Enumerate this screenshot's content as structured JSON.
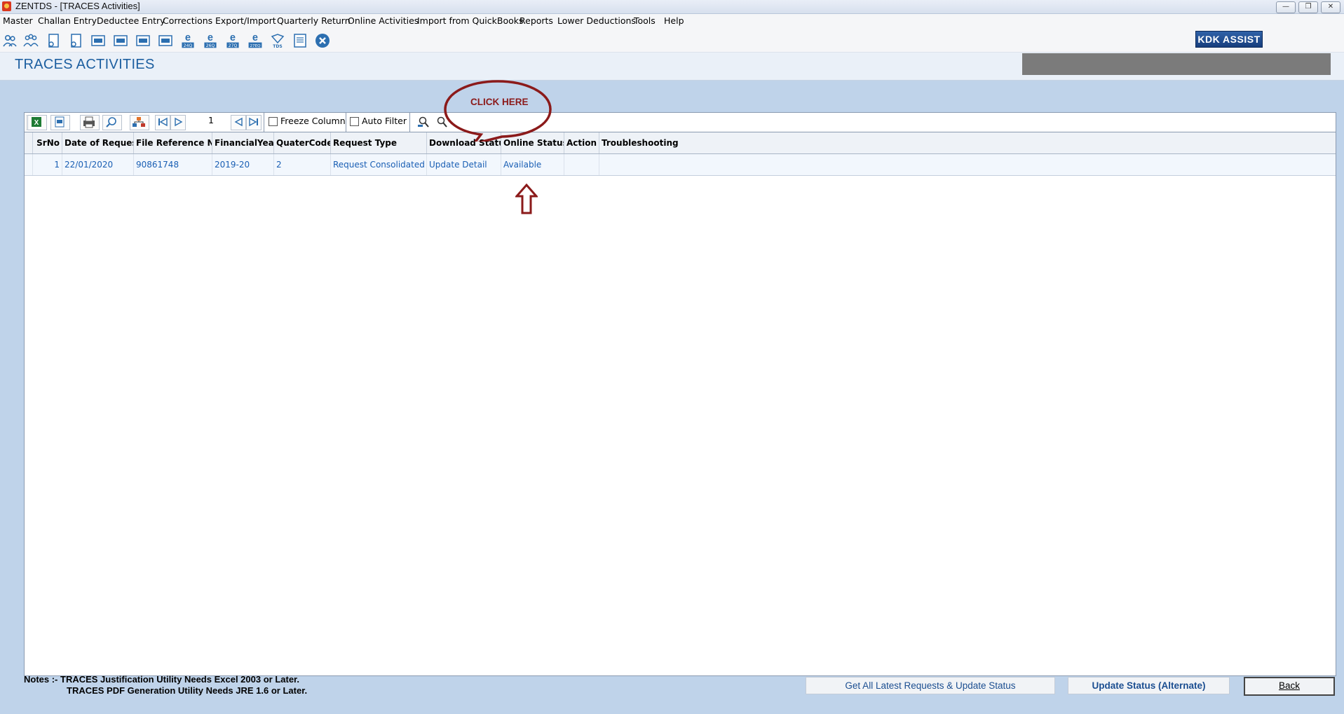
{
  "window": {
    "title": "ZENTDS - [TRACES Activities]",
    "buttons": [
      "minimize",
      "restore",
      "close"
    ]
  },
  "menu": [
    "Master",
    "Challan Entry",
    "Deductee Entry",
    "Corrections",
    "Export/Import",
    "Quarterly Return",
    "Online Activities",
    "Import from QuickBooks",
    "Reports",
    "Lower Deductions",
    "Tools",
    "Help"
  ],
  "toolbar": {
    "icons": [
      "deductor-icon",
      "deductees-icon",
      "form-icon",
      "form-icon-2",
      "form-24q-icon",
      "form-26q-icon",
      "form-27q-icon",
      "form-27eq-icon",
      "etds-24q-icon",
      "etds-26q-icon",
      "etds-27q-icon",
      "etds-27eq-icon",
      "tds-icon",
      "report-icon",
      "close-icon"
    ],
    "etds_labels": [
      "24Q",
      "26Q",
      "27Q",
      "27EQ"
    ],
    "kdk_label": "KDK ASSIST"
  },
  "page": {
    "title": "TRACES ACTIVITIES"
  },
  "grid_tools": {
    "page_number": "1",
    "freeze_label": "Freeze Column",
    "autofilter_label": "Auto Filter"
  },
  "grid": {
    "columns": [
      "SrNo",
      "Date of Request",
      "File Reference No",
      "FinancialYear",
      "QuaterCode",
      "Request Type",
      "Download Status",
      "Online Status",
      "Action",
      "Troubleshooting"
    ],
    "rows": [
      [
        "1",
        "22/01/2020",
        "90861748",
        "2019-20",
        "2",
        "Request Consolidated",
        "Update Detail",
        "Available",
        "",
        ""
      ]
    ]
  },
  "annotation": {
    "callout": "CLICK HERE",
    "colors": {
      "callout": "#8b1a1a"
    }
  },
  "footer": {
    "notes_line1": "Notes :- TRACES Justification Utility Needs Excel 2003 or Later.",
    "notes_line2": "TRACES PDF Generation Utility Needs JRE 1.6 or Later.",
    "get_all_label": "Get All Latest Requests & Update Status",
    "update_alt_label": "Update Status (Alternate)",
    "back_label": "Back"
  },
  "colors": {
    "background": "#bfd3ea",
    "title": "#1d5fa0",
    "cell_text": "#1a5fb4"
  }
}
